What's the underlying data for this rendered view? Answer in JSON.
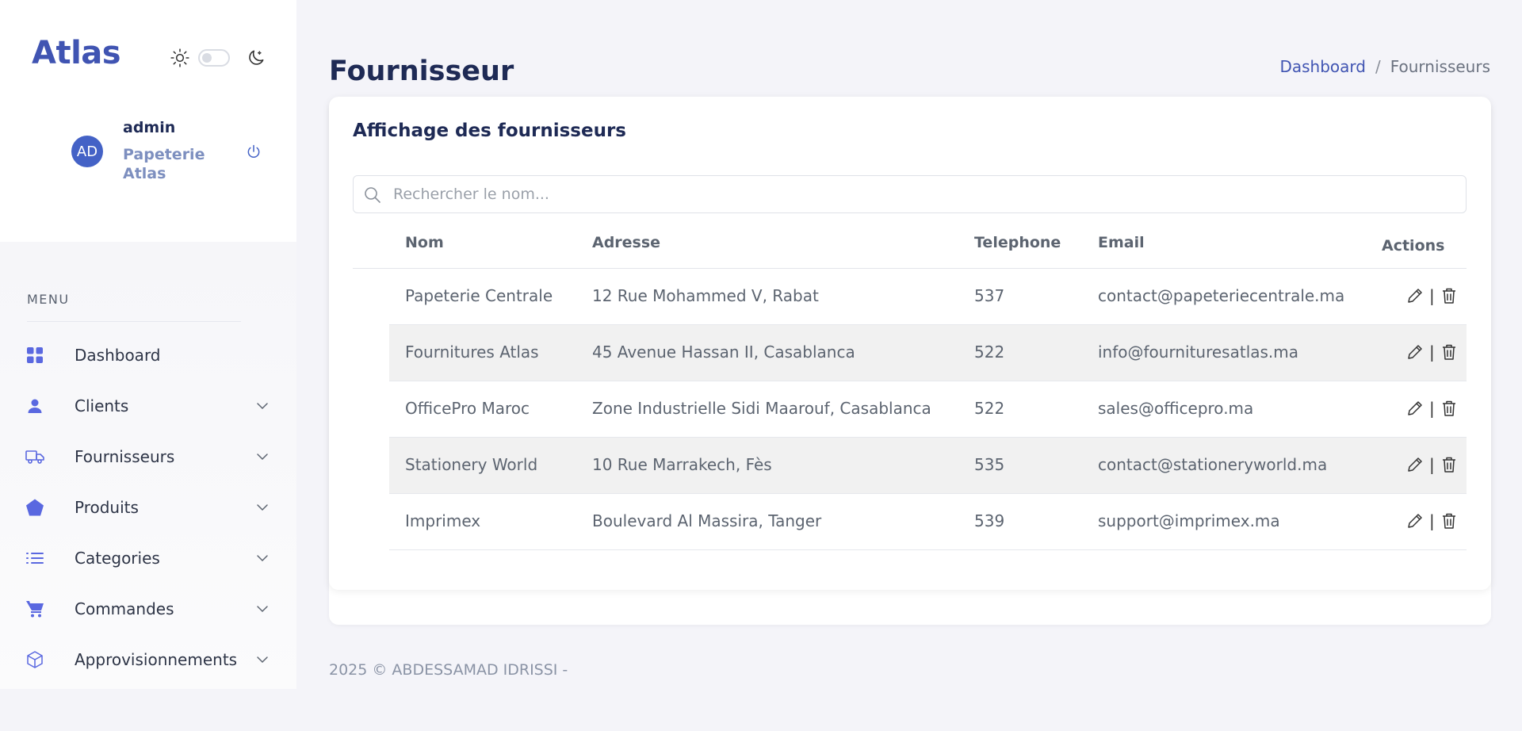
{
  "brand": "Atlas",
  "user": {
    "initials": "AD",
    "name": "admin",
    "organization": "Papeterie Atlas"
  },
  "menu": {
    "title": "MENU",
    "items": [
      {
        "label": "Dashboard",
        "icon": "grid-icon",
        "has_submenu": false
      },
      {
        "label": "Clients",
        "icon": "user-icon",
        "has_submenu": true
      },
      {
        "label": "Fournisseurs",
        "icon": "truck-icon",
        "has_submenu": true
      },
      {
        "label": "Produits",
        "icon": "pentagon-icon",
        "has_submenu": true
      },
      {
        "label": "Categories",
        "icon": "list-icon",
        "has_submenu": true
      },
      {
        "label": "Commandes",
        "icon": "cart-icon",
        "has_submenu": true
      },
      {
        "label": "Approvisionnements",
        "icon": "box-icon",
        "has_submenu": true
      }
    ]
  },
  "page": {
    "title": "Fournisseur"
  },
  "breadcrumb": {
    "home": "Dashboard",
    "separator": "/",
    "current": "Fournisseurs"
  },
  "card": {
    "title": "Affichage des fournisseurs"
  },
  "search": {
    "placeholder": "Rechercher le nom..."
  },
  "table": {
    "headers": {
      "nom": "Nom",
      "adresse": "Adresse",
      "telephone": "Telephone",
      "email": "Email",
      "actions": "Actions"
    },
    "rows": [
      {
        "nom": "Papeterie Centrale",
        "adresse": "12 Rue Mohammed V, Rabat",
        "telephone": "537",
        "email": "contact@papeteriecentrale.ma"
      },
      {
        "nom": "Fournitures Atlas",
        "adresse": "45 Avenue Hassan II, Casablanca",
        "telephone": "522",
        "email": "info@fournituresatlas.ma"
      },
      {
        "nom": "OfficePro Maroc",
        "adresse": "Zone Industrielle Sidi Maarouf, Casablanca",
        "telephone": "522",
        "email": "sales@officepro.ma"
      },
      {
        "nom": "Stationery World",
        "adresse": "10 Rue Marrakech, Fès",
        "telephone": "535",
        "email": "contact@stationeryworld.ma"
      },
      {
        "nom": "Imprimex",
        "adresse": "Boulevard Al Massira, Tanger",
        "telephone": "539",
        "email": "support@imprimex.ma"
      }
    ],
    "action_separator": "|"
  },
  "footer": {
    "text": "2025 © ABDESSAMAD IDRISSI -"
  },
  "colors": {
    "accent": "#4054b2",
    "menu_icon": "#5a68e0",
    "heading": "#1e2a55",
    "stripe": "#f1f1f1"
  }
}
